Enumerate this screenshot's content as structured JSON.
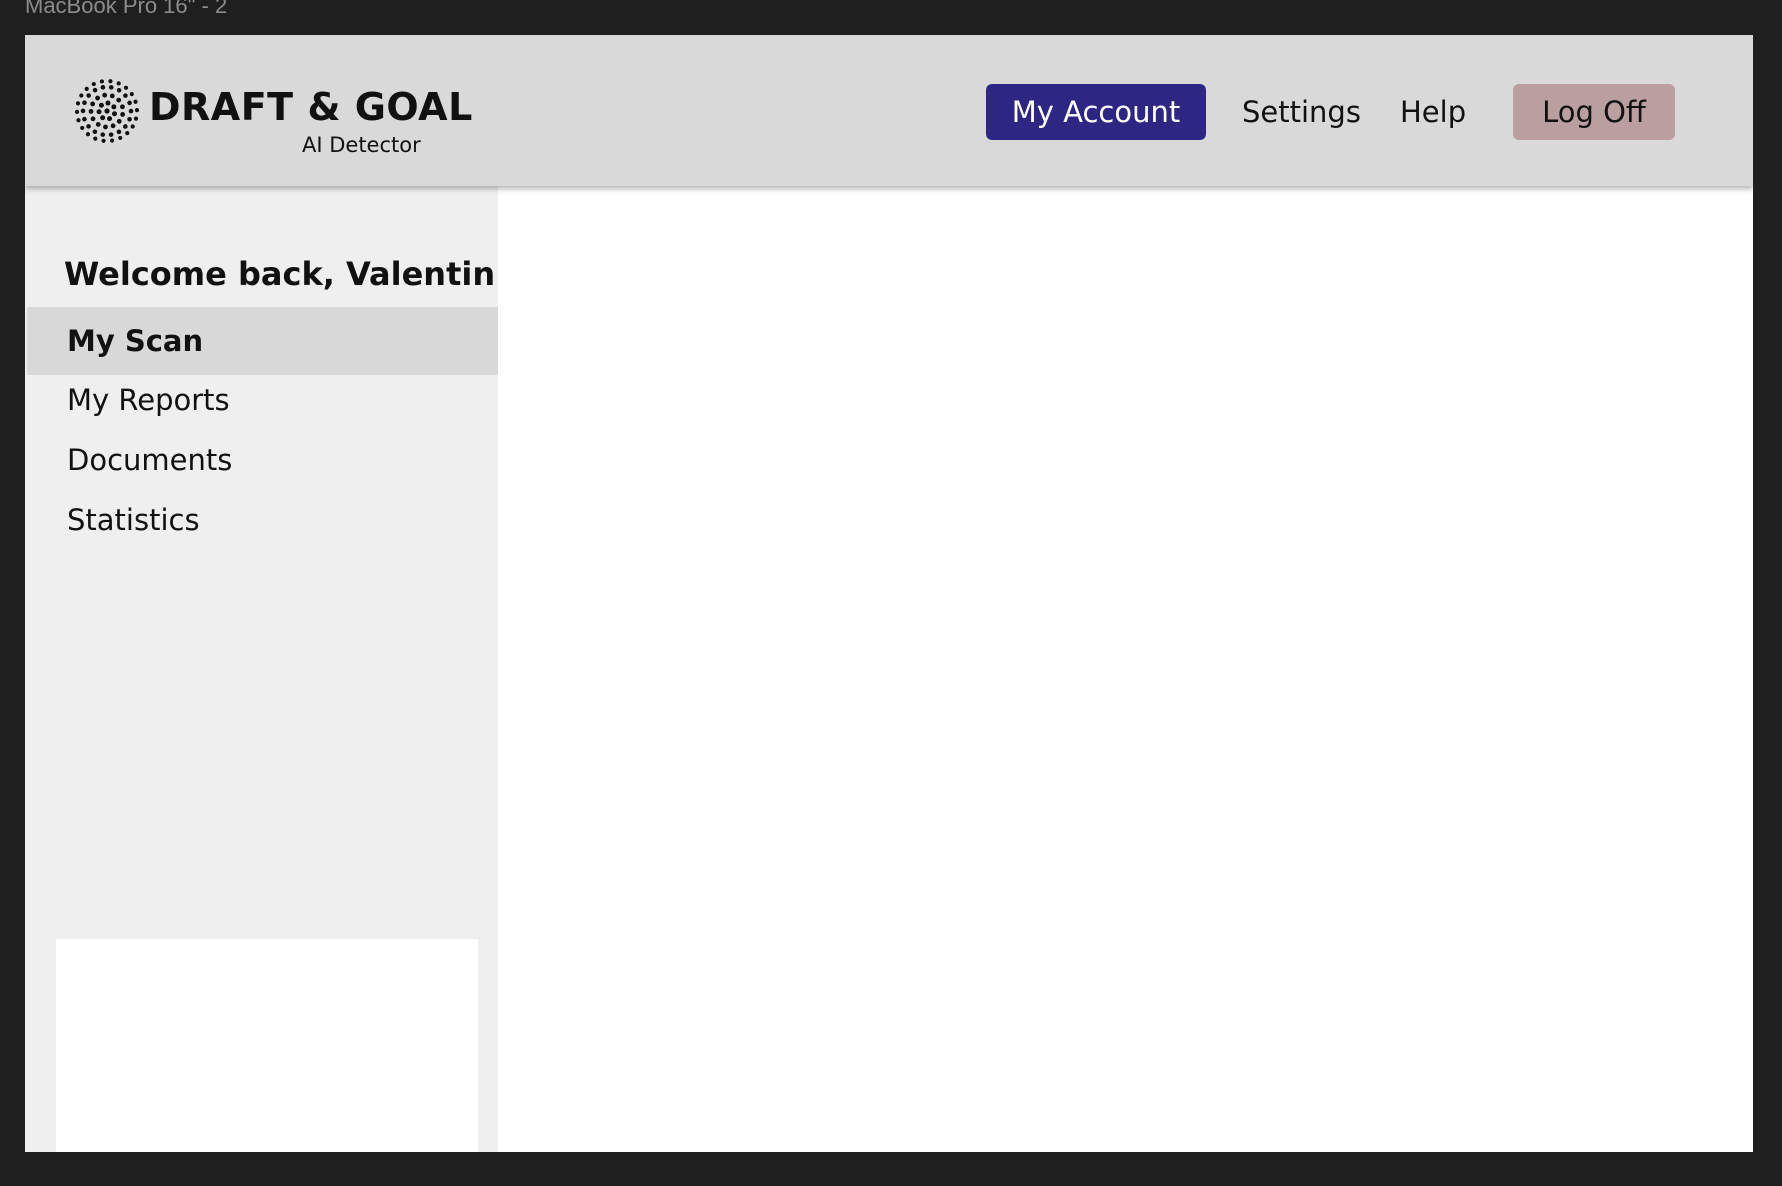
{
  "canvas": {
    "frame_label": "MacBook Pro 16\" - 2"
  },
  "header": {
    "brand": {
      "name": "DRAFT & GOAL",
      "tagline": "AI Detector"
    },
    "nav": {
      "my_account": "My Account",
      "settings": "Settings",
      "help": "Help",
      "log_off": "Log Off"
    },
    "colors": {
      "accent": "#2e2683",
      "log_off": "#bb9fa0",
      "header_bg": "#d9d9d9"
    }
  },
  "sidebar": {
    "welcome": "Welcome back, Valentin",
    "items": [
      {
        "label": "My Scan",
        "active": true
      },
      {
        "label": "My Reports",
        "active": false
      },
      {
        "label": "Documents",
        "active": false
      },
      {
        "label": "Statistics",
        "active": false
      }
    ]
  },
  "icons": {
    "logo": "dotted-circle-logo-icon"
  }
}
